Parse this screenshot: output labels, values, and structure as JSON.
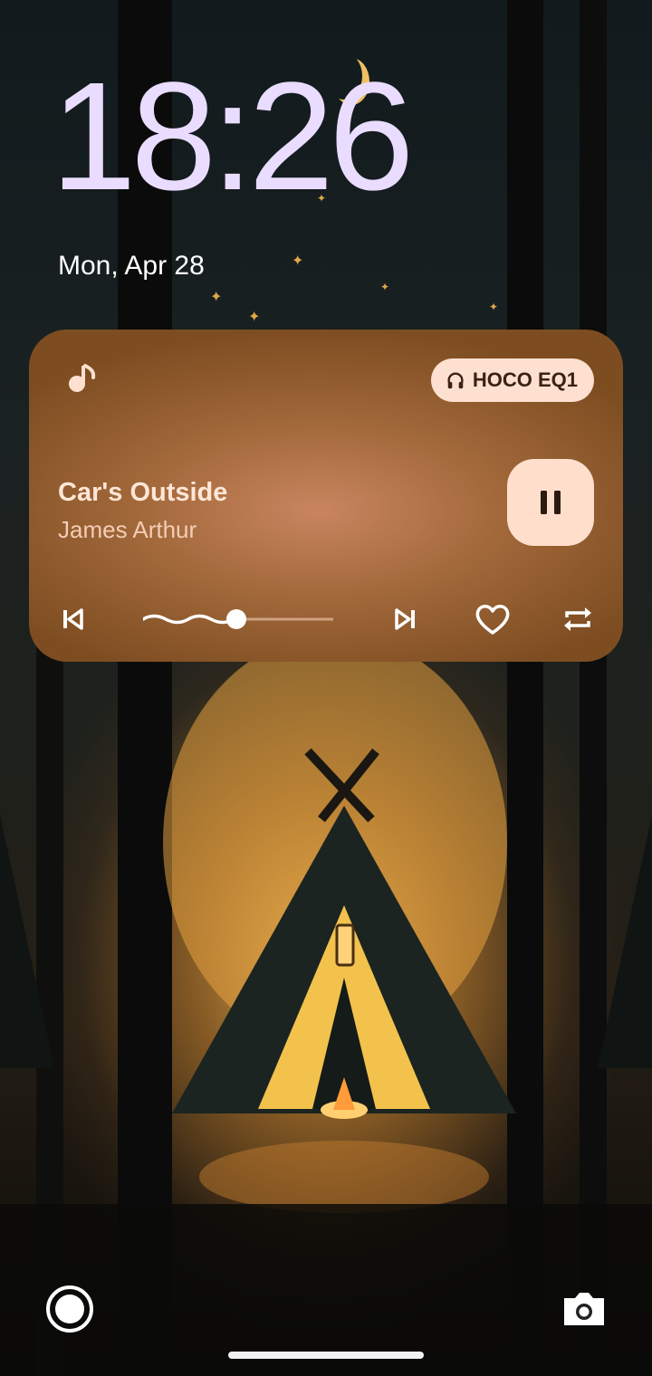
{
  "lockscreen": {
    "time": "18:26",
    "date": "Mon, Apr 28"
  },
  "media": {
    "app_icon": "music-note-icon",
    "output_device": "HOCO EQ1",
    "output_icon": "headphones-icon",
    "title": "Car's Outside",
    "artist": "James Arthur",
    "progress": 0.49,
    "controls": {
      "play_pause": "pause-icon",
      "previous": "skip-previous-icon",
      "next": "skip-next-icon",
      "like": "heart-icon",
      "repeat": "repeat-icon"
    },
    "accent": "#ffdfcc"
  },
  "shortcuts": {
    "left": "wallet-ring-icon",
    "right": "camera-icon"
  },
  "colors": {
    "clock": "#eadcff",
    "card": "#a46a3c",
    "chip": "#fde0cf"
  }
}
